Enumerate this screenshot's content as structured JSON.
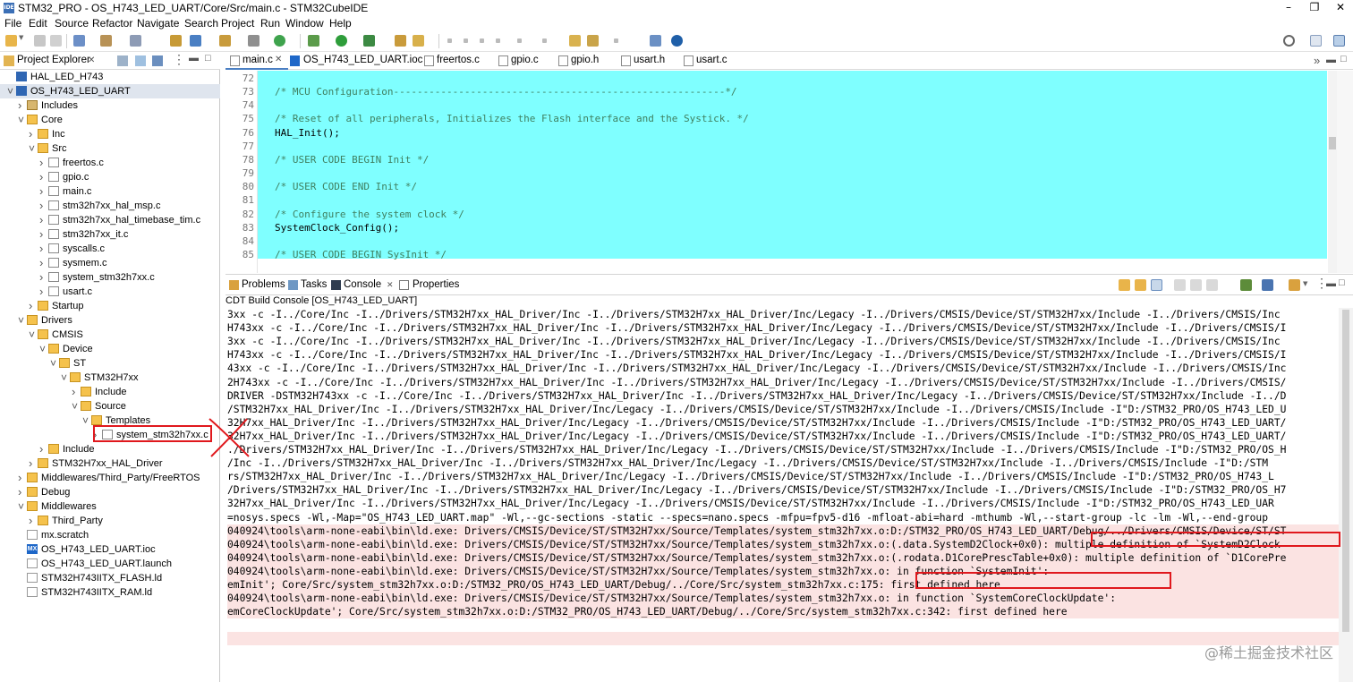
{
  "window": {
    "title": "STM32_PRO - OS_H743_LED_UART/Core/Src/main.c - STM32CubeIDE",
    "app_icon": "IDE",
    "controls": [
      "minimize",
      "restore",
      "close"
    ]
  },
  "menu": [
    "File",
    "Edit",
    "Source",
    "Refactor",
    "Navigate",
    "Search",
    "Project",
    "Run",
    "Window",
    "Help"
  ],
  "explorer": {
    "title": "Project Explorer",
    "title_id": "Project Explorer ✕",
    "tree": [
      {
        "label": "HAL_LED_H743",
        "icon": "ide-project-icon",
        "depth": 0,
        "arrow": ""
      },
      {
        "label": "OS_H743_LED_UART",
        "icon": "ide-project-icon",
        "depth": 0,
        "arrow": "v",
        "selected": true
      },
      {
        "label": "Includes",
        "icon": "includes-icon",
        "depth": 1,
        "arrow": ">"
      },
      {
        "label": "Core",
        "icon": "folder-icon",
        "depth": 1,
        "arrow": "v"
      },
      {
        "label": "Inc",
        "icon": "folder-icon",
        "depth": 2,
        "arrow": ">"
      },
      {
        "label": "Src",
        "icon": "folder-icon",
        "depth": 2,
        "arrow": "v"
      },
      {
        "label": "freertos.c",
        "icon": "c-file-icon",
        "depth": 3,
        "arrow": ">"
      },
      {
        "label": "gpio.c",
        "icon": "c-file-icon",
        "depth": 3,
        "arrow": ">"
      },
      {
        "label": "main.c",
        "icon": "c-file-icon",
        "depth": 3,
        "arrow": ">"
      },
      {
        "label": "stm32h7xx_hal_msp.c",
        "icon": "c-file-icon",
        "depth": 3,
        "arrow": ">"
      },
      {
        "label": "stm32h7xx_hal_timebase_tim.c",
        "icon": "c-file-icon",
        "depth": 3,
        "arrow": ">"
      },
      {
        "label": "stm32h7xx_it.c",
        "icon": "c-file-icon",
        "depth": 3,
        "arrow": ">"
      },
      {
        "label": "syscalls.c",
        "icon": "c-file-icon",
        "depth": 3,
        "arrow": ">"
      },
      {
        "label": "sysmem.c",
        "icon": "c-file-icon",
        "depth": 3,
        "arrow": ">"
      },
      {
        "label": "system_stm32h7xx.c",
        "icon": "c-file-icon",
        "depth": 3,
        "arrow": ">"
      },
      {
        "label": "usart.c",
        "icon": "c-file-icon",
        "depth": 3,
        "arrow": ">"
      },
      {
        "label": "Startup",
        "icon": "folder-icon",
        "depth": 2,
        "arrow": ">"
      },
      {
        "label": "Drivers",
        "icon": "folder-icon",
        "depth": 1,
        "arrow": "v"
      },
      {
        "label": "CMSIS",
        "icon": "folder-icon",
        "depth": 2,
        "arrow": "v"
      },
      {
        "label": "Device",
        "icon": "folder-icon",
        "depth": 3,
        "arrow": "v"
      },
      {
        "label": "ST",
        "icon": "folder-icon",
        "depth": 4,
        "arrow": "v"
      },
      {
        "label": "STM32H7xx",
        "icon": "folder-icon",
        "depth": 5,
        "arrow": "v"
      },
      {
        "label": "Include",
        "icon": "folder-icon",
        "depth": 6,
        "arrow": ">"
      },
      {
        "label": "Source",
        "icon": "folder-icon",
        "depth": 6,
        "arrow": "v"
      },
      {
        "label": "Templates",
        "icon": "folder-icon",
        "depth": 7,
        "arrow": "v"
      },
      {
        "label": "system_stm32h7xx.c",
        "icon": "c-file-icon",
        "depth": 8,
        "arrow": ">",
        "highlight": true
      },
      {
        "label": "Include",
        "icon": "folder-icon",
        "depth": 3,
        "arrow": ">"
      },
      {
        "label": "STM32H7xx_HAL_Driver",
        "icon": "folder-icon",
        "depth": 2,
        "arrow": ">"
      },
      {
        "label": "Middlewares/Third_Party/FreeRTOS",
        "icon": "folder-icon",
        "depth": 1,
        "arrow": ">"
      },
      {
        "label": "Debug",
        "icon": "folder-icon",
        "depth": 1,
        "arrow": ">"
      },
      {
        "label": "Middlewares",
        "icon": "folder-icon",
        "depth": 1,
        "arrow": "v"
      },
      {
        "label": "Third_Party",
        "icon": "folder-icon",
        "depth": 2,
        "arrow": ">"
      },
      {
        "label": "mx.scratch",
        "icon": "file-icon",
        "depth": 1,
        "arrow": ""
      },
      {
        "label": "OS_H743_LED_UART.ioc",
        "icon": "mx-file-icon",
        "depth": 1,
        "arrow": ""
      },
      {
        "label": "OS_H743_LED_UART.launch",
        "icon": "file-icon",
        "depth": 1,
        "arrow": ""
      },
      {
        "label": "STM32H743IITX_FLASH.ld",
        "icon": "file-icon",
        "depth": 1,
        "arrow": ""
      },
      {
        "label": "STM32H743IITX_RAM.ld",
        "icon": "file-icon",
        "depth": 1,
        "arrow": ""
      }
    ]
  },
  "editor": {
    "tabs": [
      {
        "label": "main.c",
        "active": true,
        "close": "✕"
      },
      {
        "label": "OS_H743_LED_UART.ioc"
      },
      {
        "label": "freertos.c"
      },
      {
        "label": "gpio.c"
      },
      {
        "label": "gpio.h"
      },
      {
        "label": "usart.h"
      },
      {
        "label": "usart.c"
      }
    ],
    "overflow": "»",
    "lines": [
      {
        "num": "72",
        "text": ""
      },
      {
        "num": "73",
        "text": "/* MCU Configuration--------------------------------------------------------*/",
        "kind": "comment"
      },
      {
        "num": "74",
        "text": ""
      },
      {
        "num": "75",
        "text": "/* Reset of all peripherals, Initializes the Flash interface and the Systick. */",
        "kind": "comment"
      },
      {
        "num": "76",
        "text": "HAL_Init();",
        "kind": "code"
      },
      {
        "num": "77",
        "text": ""
      },
      {
        "num": "78",
        "text": "/* USER CODE BEGIN Init */",
        "kind": "comment"
      },
      {
        "num": "79",
        "text": ""
      },
      {
        "num": "80",
        "text": "/* USER CODE END Init */",
        "kind": "comment"
      },
      {
        "num": "81",
        "text": ""
      },
      {
        "num": "82",
        "text": "/* Configure the system clock */",
        "kind": "comment"
      },
      {
        "num": "83",
        "text": "SystemClock_Config();",
        "kind": "code"
      },
      {
        "num": "84",
        "text": ""
      },
      {
        "num": "85",
        "text": "/* USER CODE BEGIN SysInit */",
        "kind": "comment"
      }
    ]
  },
  "bottom": {
    "tabs": [
      "Problems",
      "Tasks",
      "Console",
      "Properties"
    ],
    "console_close": "✕",
    "active_tab": "Console",
    "console_title": "CDT Build Console [OS_H743_LED_UART]",
    "lines": [
      {
        "text": "3xx -c -I../Core/Inc -I../Drivers/STM32H7xx_HAL_Driver/Inc -I../Drivers/STM32H7xx_HAL_Driver/Inc/Legacy -I../Drivers/CMSIS/Device/ST/STM32H7xx/Include -I../Drivers/CMSIS/Inc",
        "err": false
      },
      {
        "text": "H743xx -c -I../Core/Inc -I../Drivers/STM32H7xx_HAL_Driver/Inc -I../Drivers/STM32H7xx_HAL_Driver/Inc/Legacy -I../Drivers/CMSIS/Device/ST/STM32H7xx/Include -I../Drivers/CMSIS/I",
        "err": false
      },
      {
        "text": "3xx -c -I../Core/Inc -I../Drivers/STM32H7xx_HAL_Driver/Inc -I../Drivers/STM32H7xx_HAL_Driver/Inc/Legacy -I../Drivers/CMSIS/Device/ST/STM32H7xx/Include -I../Drivers/CMSIS/Inc",
        "err": false
      },
      {
        "text": "H743xx -c -I../Core/Inc -I../Drivers/STM32H7xx_HAL_Driver/Inc -I../Drivers/STM32H7xx_HAL_Driver/Inc/Legacy -I../Drivers/CMSIS/Device/ST/STM32H7xx/Include -I../Drivers/CMSIS/I",
        "err": false
      },
      {
        "text": "43xx -c -I../Core/Inc -I../Drivers/STM32H7xx_HAL_Driver/Inc -I../Drivers/STM32H7xx_HAL_Driver/Inc/Legacy -I../Drivers/CMSIS/Device/ST/STM32H7xx/Include -I../Drivers/CMSIS/Inc",
        "err": false
      },
      {
        "text": "2H743xx -c -I../Core/Inc -I../Drivers/STM32H7xx_HAL_Driver/Inc -I../Drivers/STM32H7xx_HAL_Driver/Inc/Legacy -I../Drivers/CMSIS/Device/ST/STM32H7xx/Include -I../Drivers/CMSIS/",
        "err": false
      },
      {
        "text": "DRIVER -DSTM32H743xx -c -I../Core/Inc -I../Drivers/STM32H7xx_HAL_Driver/Inc -I../Drivers/STM32H7xx_HAL_Driver/Inc/Legacy -I../Drivers/CMSIS/Device/ST/STM32H7xx/Include -I../D",
        "err": false
      },
      {
        "text": "/STM32H7xx_HAL_Driver/Inc -I../Drivers/STM32H7xx_HAL_Driver/Inc/Legacy -I../Drivers/CMSIS/Device/ST/STM32H7xx/Include -I../Drivers/CMSIS/Include -I\"D:/STM32_PRO/OS_H743_LED_U",
        "err": false
      },
      {
        "text": "32H7xx_HAL_Driver/Inc -I../Drivers/STM32H7xx_HAL_Driver/Inc/Legacy -I../Drivers/CMSIS/Device/ST/STM32H7xx/Include -I../Drivers/CMSIS/Include -I\"D:/STM32_PRO/OS_H743_LED_UART/",
        "err": false
      },
      {
        "text": "32H7xx_HAL_Driver/Inc -I../Drivers/STM32H7xx_HAL_Driver/Inc/Legacy -I../Drivers/CMSIS/Device/ST/STM32H7xx/Include -I../Drivers/CMSIS/Include -I\"D:/STM32_PRO/OS_H743_LED_UART/",
        "err": false
      },
      {
        "text": "./Drivers/STM32H7xx_HAL_Driver/Inc -I../Drivers/STM32H7xx_HAL_Driver/Inc/Legacy -I../Drivers/CMSIS/Device/ST/STM32H7xx/Include -I../Drivers/CMSIS/Include -I\"D:/STM32_PRO/OS_H",
        "err": false
      },
      {
        "text": "/Inc -I../Drivers/STM32H7xx_HAL_Driver/Inc -I../Drivers/STM32H7xx_HAL_Driver/Inc/Legacy -I../Drivers/CMSIS/Device/ST/STM32H7xx/Include -I../Drivers/CMSIS/Include -I\"D:/STM",
        "err": false
      },
      {
        "text": "rs/STM32H7xx_HAL_Driver/Inc -I../Drivers/STM32H7xx_HAL_Driver/Inc/Legacy -I../Drivers/CMSIS/Device/ST/STM32H7xx/Include -I../Drivers/CMSIS/Include -I\"D:/STM32_PRO/OS_H743_L",
        "err": false
      },
      {
        "text": "/Drivers/STM32H7xx_HAL_Driver/Inc -I../Drivers/STM32H7xx_HAL_Driver/Inc/Legacy -I../Drivers/CMSIS/Device/ST/STM32H7xx/Include -I../Drivers/CMSIS/Include -I\"D:/STM32_PRO/OS_H7",
        "err": false
      },
      {
        "text": "32H7xx_HAL_Driver/Inc -I../Drivers/STM32H7xx_HAL_Driver/Inc/Legacy -I../Drivers/CMSIS/Device/ST/STM32H7xx/Include -I../Drivers/CMSIS/Include -I\"D:/STM32_PRO/OS_H743_LED_UAR",
        "err": false
      },
      {
        "text": "=nosys.specs -Wl,-Map=\"OS_H743_LED_UART.map\" -Wl,--gc-sections -static --specs=nano.specs -mfpu=fpv5-d16 -mfloat-abi=hard -mthumb -Wl,--start-group -lc -lm -Wl,--end-group",
        "err": false
      },
      {
        "text": "040924\\tools\\arm-none-eabi\\bin\\ld.exe: Drivers/CMSIS/Device/ST/STM32H7xx/Source/Templates/system_stm32h7xx.o:D:/STM32_PRO/OS_H743_LED_UART/Debug/../Drivers/CMSIS/Device/ST/ST",
        "err": true
      },
      {
        "text": "040924\\tools\\arm-none-eabi\\bin\\ld.exe: Drivers/CMSIS/Device/ST/STM32H7xx/Source/Templates/system_stm32h7xx.o:(.data.SystemD2Clock+0x0): multiple definition of `SystemD2Clock",
        "err": true
      },
      {
        "text": "040924\\tools\\arm-none-eabi\\bin\\ld.exe: Drivers/CMSIS/Device/ST/STM32H7xx/Source/Templates/system_stm32h7xx.o:(.rodata.D1CorePrescTable+0x0): multiple definition of `D1CorePre",
        "err": true
      },
      {
        "text": "040924\\tools\\arm-none-eabi\\bin\\ld.exe: Drivers/CMSIS/Device/ST/STM32H7xx/Source/Templates/system_stm32h7xx.o: in function `SystemInit':",
        "err": true
      },
      {
        "text": "emInit'; Core/Src/system_stm32h7xx.o:D:/STM32_PRO/OS_H743_LED_UART/Debug/../Core/Src/system_stm32h7xx.c:175: first defined here",
        "err": true
      },
      {
        "text": "040924\\tools\\arm-none-eabi\\bin\\ld.exe: Drivers/CMSIS/Device/ST/STM32H7xx/Source/Templates/system_stm32h7xx.o: in function `SystemCoreClockUpdate':",
        "err": true
      },
      {
        "text": "emCoreClockUpdate'; Core/Src/system_stm32h7xx.o:D:/STM32_PRO/OS_H743_LED_UART/Debug/../Core/Src/system_stm32h7xx.c:342: first defined here",
        "err": true
      },
      {
        "text": "",
        "err": false
      },
      {
        "text": "",
        "err": true
      }
    ]
  },
  "watermark": "@稀土掘金技术社区",
  "colors": {
    "editor_bg": "#7fffff",
    "error_bg": "#fbe3e2",
    "annotation_red": "#e0181d",
    "comment": "#3f7f5f"
  }
}
